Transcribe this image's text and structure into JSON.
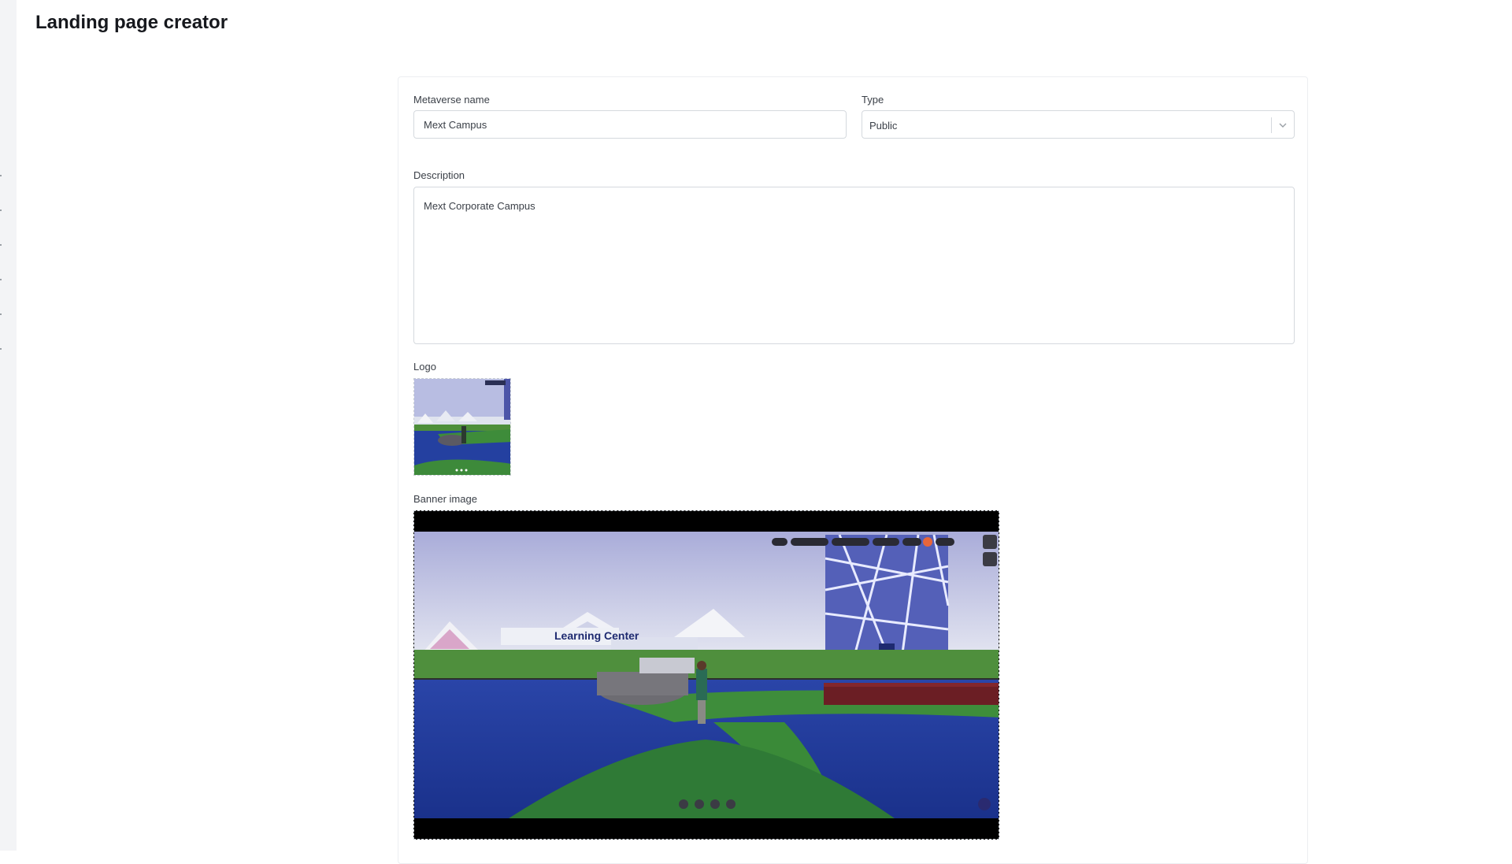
{
  "page": {
    "title": "Landing page creator"
  },
  "form": {
    "name": {
      "label": "Metaverse name",
      "value": "Mext Campus"
    },
    "type": {
      "label": "Type",
      "value": "Public"
    },
    "description": {
      "label": "Description",
      "value": "Mext Corporate Campus"
    },
    "logo": {
      "label": "Logo"
    },
    "banner": {
      "label": "Banner image",
      "scene_sign": "Learning Center"
    }
  },
  "icons": {
    "chevron": "chevron-down-icon"
  },
  "colors": {
    "title": "#16181d",
    "border": "#d5d9de",
    "sky": "#b9bde0",
    "water": "#1f3a9c",
    "grass": "#3d8a3a"
  }
}
